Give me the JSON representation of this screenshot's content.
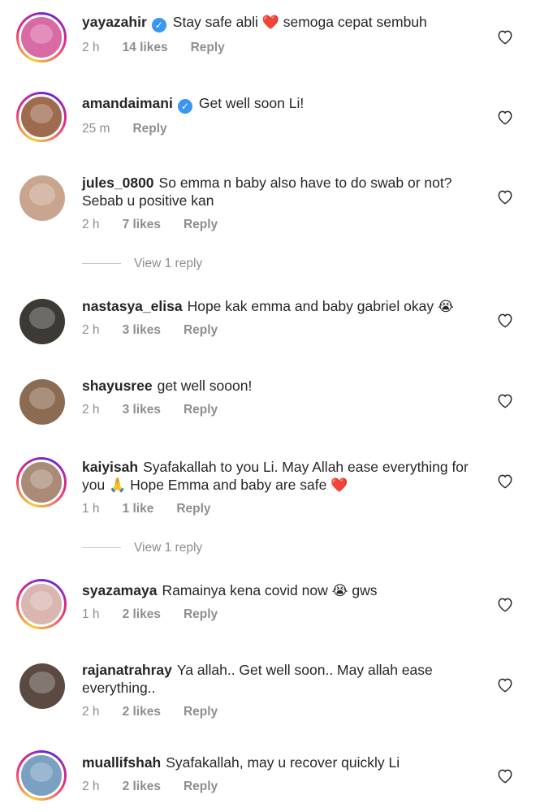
{
  "comments": [
    {
      "username": "yayazahir",
      "verified": true,
      "text_parts": [
        "Stay safe abli ",
        " semoga cepat sembuh"
      ],
      "emoji": "❤️",
      "time": "2 h",
      "likes": "14 likes",
      "reply": "Reply",
      "avatar_color": "#d86aa4",
      "story_ring": true
    },
    {
      "username": "amandaimani",
      "verified": true,
      "text": "Get well soon Li!",
      "time": "25 m",
      "reply": "Reply",
      "avatar_color": "#9f6b4f",
      "story_ring": true
    },
    {
      "username": "jules_0800",
      "text": "So emma n baby also have to do swab or not? Sebab u positive kan",
      "time": "2 h",
      "likes": "7 likes",
      "reply": "Reply",
      "avatar_color": "#c9a58f",
      "story_ring": false
    },
    {
      "username": "nastasya_elisa",
      "text": "Hope kak emma and baby gabriel okay",
      "emoji": "😭",
      "time": "2 h",
      "likes": "3 likes",
      "reply": "Reply",
      "avatar_color": "#3d3a36",
      "story_ring": false
    },
    {
      "username": "shayusree",
      "text": "get well sooon!",
      "time": "2 h",
      "likes": "3 likes",
      "reply": "Reply",
      "avatar_color": "#8b6b52",
      "story_ring": false
    },
    {
      "username": "kaiyisah",
      "text_parts": [
        "Syafakallah to you Li. May Allah ease everything for you ",
        " Hope Emma and baby are safe "
      ],
      "emoji": "🙏",
      "emoji2": "❤️",
      "time": "1 h",
      "likes": "1 like",
      "reply": "Reply",
      "avatar_color": "#a98b77",
      "story_ring": true
    },
    {
      "username": "syazamaya",
      "text_parts": [
        "Ramainya kena covid now ",
        " gws"
      ],
      "emoji": "😭",
      "time": "1 h",
      "likes": "2 likes",
      "reply": "Reply",
      "avatar_color": "#d9b6b0",
      "story_ring": true
    },
    {
      "username": "rajanatrahray",
      "text": "Ya allah.. Get well soon.. May allah ease everything..",
      "time": "2 h",
      "likes": "2 likes",
      "reply": "Reply",
      "avatar_color": "#5a4a42",
      "story_ring": false
    },
    {
      "username": "muallifshah",
      "text": "Syafakallah, may u recover quickly Li",
      "time": "2 h",
      "likes": "2 likes",
      "reply": "Reply",
      "avatar_color": "#7aa0c2",
      "story_ring": true
    }
  ],
  "view_replies": [
    "View 1 reply",
    "View 1 reply"
  ],
  "icons": {
    "like": "heart-outline-icon",
    "verified": "verified-badge-icon"
  },
  "colors": {
    "verified": "#3897f0",
    "meta": "#8e8e8e",
    "text": "#262626"
  }
}
